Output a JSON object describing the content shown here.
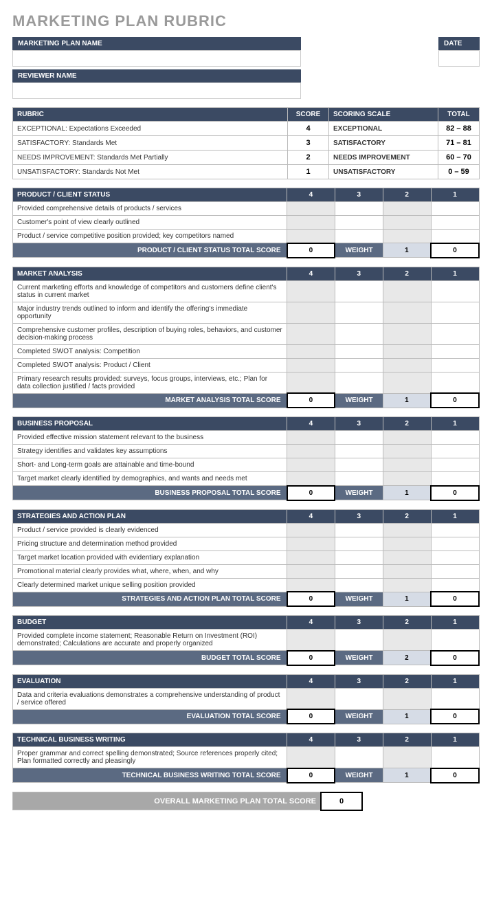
{
  "title": "MARKETING PLAN RUBRIC",
  "meta": {
    "plan_label": "MARKETING PLAN NAME",
    "date_label": "DATE",
    "reviewer_label": "REVIEWER NAME"
  },
  "rubric": {
    "hdr_rubric": "RUBRIC",
    "hdr_score": "SCORE",
    "hdr_scale": "SCORING SCALE",
    "hdr_total": "TOTAL",
    "rows": [
      {
        "desc": "EXCEPTIONAL: Expectations Exceeded",
        "score": "4",
        "scale": "EXCEPTIONAL",
        "total": "82 – 88"
      },
      {
        "desc": "SATISFACTORY: Standards Met",
        "score": "3",
        "scale": "SATISFACTORY",
        "total": "71 – 81"
      },
      {
        "desc": "NEEDS IMPROVEMENT: Standards Met Partially",
        "score": "2",
        "scale": "NEEDS IMPROVEMENT",
        "total": "60 – 70"
      },
      {
        "desc": "UNSATISFACTORY: Standards Not Met",
        "score": "1",
        "scale": "UNSATISFACTORY",
        "total": "0 – 59"
      }
    ]
  },
  "weight_lbl": "WEIGHT",
  "sections": [
    {
      "title": "PRODUCT / CLIENT STATUS",
      "total_label": "PRODUCT / CLIENT STATUS TOTAL SCORE",
      "score": "0",
      "weight": "1",
      "result": "0",
      "items": [
        "Provided comprehensive details of products / services",
        "Customer's point of view clearly outlined",
        "Product / service competitive position provided; key competitors named"
      ]
    },
    {
      "title": "MARKET ANALYSIS",
      "total_label": "MARKET ANALYSIS TOTAL SCORE",
      "score": "0",
      "weight": "1",
      "result": "0",
      "items": [
        "Current marketing efforts and knowledge of competitors and customers define client's status in current market",
        "Major industry trends outlined to inform and identify the offering's immediate opportunity",
        "Comprehensive customer profiles, description of buying roles, behaviors, and customer decision-making process",
        "Completed SWOT analysis: Competition",
        "Completed SWOT analysis: Product / Client",
        "Primary research results provided: surveys, focus groups, interviews, etc.; Plan for data collection justified / facts provided"
      ]
    },
    {
      "title": "BUSINESS PROPOSAL",
      "total_label": "BUSINESS PROPOSAL TOTAL SCORE",
      "score": "0",
      "weight": "1",
      "result": "0",
      "items": [
        "Provided effective mission statement relevant to the business",
        "Strategy identifies and validates key assumptions",
        "Short- and Long-term goals are attainable and time-bound",
        "Target market clearly identified by demographics, and wants and needs met"
      ]
    },
    {
      "title": "STRATEGIES AND ACTION PLAN",
      "total_label": "STRATEGIES AND ACTION PLAN TOTAL SCORE",
      "score": "0",
      "weight": "1",
      "result": "0",
      "items": [
        "Product / service provided is clearly evidenced",
        "Pricing structure and determination method provided",
        "Target market location provided with evidentiary explanation",
        "Promotional material clearly provides what, where, when, and why",
        "Clearly determined market unique selling position provided"
      ]
    },
    {
      "title": "BUDGET",
      "total_label": "BUDGET TOTAL SCORE",
      "score": "0",
      "weight": "2",
      "result": "0",
      "items": [
        "Provided complete income statement; Reasonable Return on Investment (ROI) demonstrated; Calculations are accurate and properly organized"
      ]
    },
    {
      "title": "EVALUATION",
      "total_label": "EVALUATION TOTAL SCORE",
      "score": "0",
      "weight": "1",
      "result": "0",
      "items": [
        "Data and criteria evaluations demonstrates a comprehensive understanding of product / service offered"
      ]
    },
    {
      "title": "TECHNICAL BUSINESS WRITING",
      "total_label": "TECHNICAL BUSINESS WRITING TOTAL SCORE",
      "score": "0",
      "weight": "1",
      "result": "0",
      "items": [
        "Proper grammar and correct spelling demonstrated; Source references properly cited; Plan formatted correctly and pleasingly"
      ]
    }
  ],
  "score_cols": [
    "4",
    "3",
    "2",
    "1"
  ],
  "overall": {
    "label": "OVERALL MARKETING PLAN TOTAL SCORE",
    "value": "0"
  }
}
